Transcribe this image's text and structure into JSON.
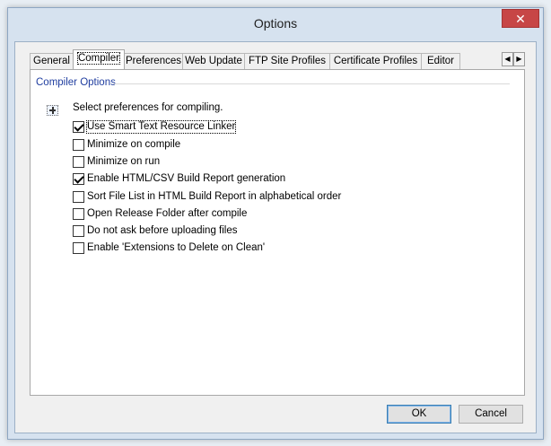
{
  "window": {
    "title": "Options",
    "close_glyph": "✕"
  },
  "tabs": [
    {
      "label": "General",
      "active": false
    },
    {
      "label": "Compiler",
      "active": true
    },
    {
      "label": "Preferences",
      "active": false
    },
    {
      "label": "Web Update",
      "active": false
    },
    {
      "label": "FTP Site Profiles",
      "active": false
    },
    {
      "label": "Certificate Profiles",
      "active": false
    },
    {
      "label": "Editor",
      "active": false
    }
  ],
  "tab_scroll": {
    "left_glyph": "◀",
    "right_glyph": "▶"
  },
  "group": {
    "title": "Compiler Options",
    "description": "Select preferences for compiling.",
    "icon": "expand-icon"
  },
  "options": [
    {
      "label": "Use Smart Text Resource Linker",
      "checked": true
    },
    {
      "label": "Minimize on compile",
      "checked": false
    },
    {
      "label": "Minimize on run",
      "checked": false
    },
    {
      "label": "Enable HTML/CSV Build Report generation",
      "checked": true
    },
    {
      "label": "Sort File List in HTML Build Report in alphabetical order",
      "checked": false
    },
    {
      "label": "Open Release Folder after compile",
      "checked": false
    },
    {
      "label": "Do not ask before uploading files",
      "checked": false
    },
    {
      "label": "Enable 'Extensions to Delete on Clean'",
      "checked": false
    }
  ],
  "buttons": {
    "ok": "OK",
    "cancel": "Cancel"
  },
  "colors": {
    "accent": "#1f3d9f",
    "close": "#c74646",
    "window_frame": "#d6e2ef"
  }
}
